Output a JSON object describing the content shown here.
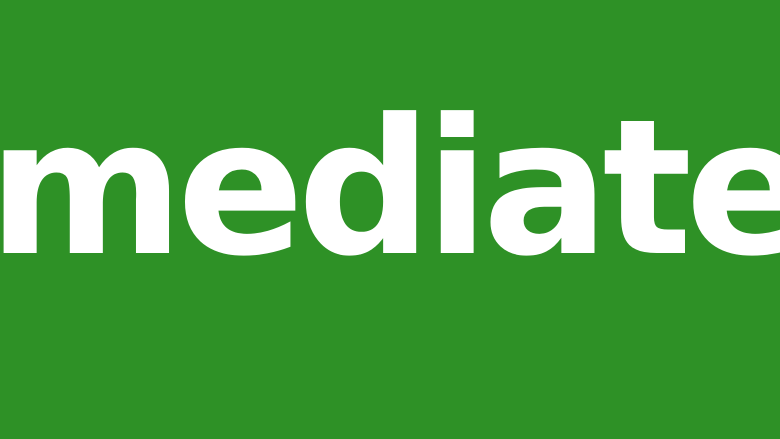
{
  "banner": {
    "word": "mediately",
    "background_color": "#2e9126",
    "text_color": "#ffffff"
  }
}
